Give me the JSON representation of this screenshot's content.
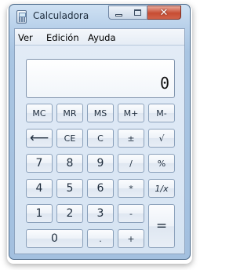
{
  "window": {
    "title": "Calculadora",
    "controls": {
      "minimize": "minimize",
      "maximize": "maximize",
      "close": "✕"
    }
  },
  "menu": {
    "items": [
      "Ver",
      "Edición",
      "Ayuda"
    ]
  },
  "display": {
    "value": "0"
  },
  "keys": {
    "mc": "MC",
    "mr": "MR",
    "ms": "MS",
    "mplus": "M+",
    "mminus": "M-",
    "backspace": "⟵",
    "ce": "CE",
    "c": "C",
    "plusminus": "±",
    "sqrt": "√",
    "seven": "7",
    "eight": "8",
    "nine": "9",
    "divide": "/",
    "percent": "%",
    "four": "4",
    "five": "5",
    "six": "6",
    "multiply": "*",
    "reciprocal": "1/x",
    "one": "1",
    "two": "2",
    "three": "3",
    "minus": "-",
    "equals": "=",
    "zero": "0",
    "decimal": ".",
    "plus": "+"
  }
}
